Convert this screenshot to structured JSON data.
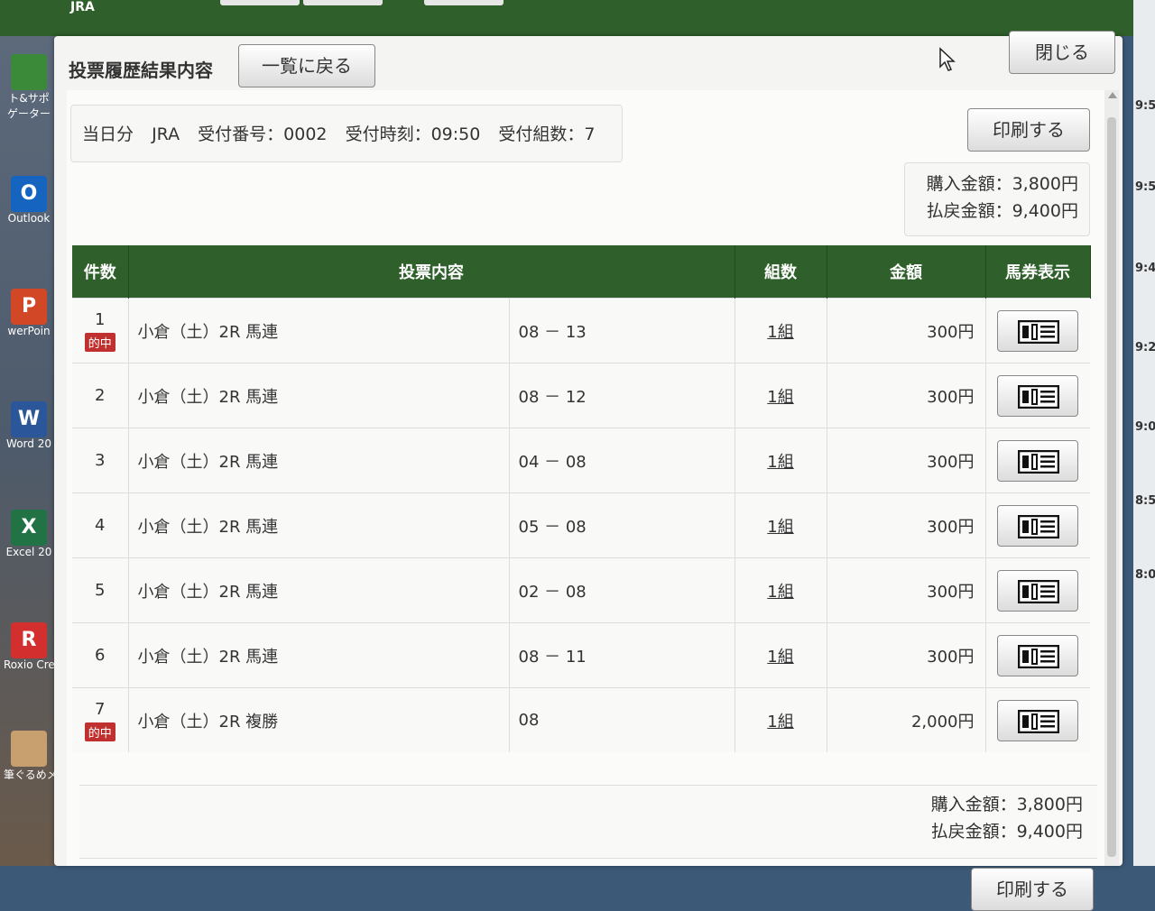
{
  "background": {
    "logo": "JRA",
    "desktop_icons": [
      {
        "label": "ト&サポ",
        "sub": "ゲーター",
        "glyph": "",
        "color": "#3a8a3a",
        "icon": "support-icon"
      },
      {
        "label": "Outlook",
        "sub": "",
        "glyph": "O",
        "color": "#1565c0",
        "icon": "outlook-icon"
      },
      {
        "label": "werPoin",
        "sub": "",
        "glyph": "P",
        "color": "#d24726",
        "icon": "powerpoint-icon"
      },
      {
        "label": "Word 20",
        "sub": "",
        "glyph": "W",
        "color": "#2b579a",
        "icon": "word-icon"
      },
      {
        "label": "Excel 20",
        "sub": "",
        "glyph": "X",
        "color": "#217346",
        "icon": "excel-icon"
      },
      {
        "label": "Roxio Crea",
        "sub": "",
        "glyph": "R",
        "color": "#d32f2f",
        "icon": "roxio-icon"
      },
      {
        "label": "筆ぐるめメ",
        "sub": "",
        "glyph": "",
        "color": "#c8a070",
        "icon": "fudegurume-icon"
      }
    ],
    "right_times": [
      "9:5",
      "9:5",
      "9:4",
      "9:2",
      "9:0",
      "8:5",
      "8:0"
    ]
  },
  "modal": {
    "title": "投票履歴結果内容",
    "back_label": "一覧に戻る",
    "close_label": "閉じる",
    "print_label": "印刷する",
    "info": {
      "day": "当日分",
      "org": "JRA",
      "receipt_no": "受付番号：0002",
      "receipt_time": "受付時刻：09:50",
      "receipt_sets": "受付組数：7"
    },
    "summary": {
      "purchase": "購入金額：3,800円",
      "payout": "払戻金額：9,400円"
    },
    "table": {
      "headers": {
        "count": "件数",
        "content": "投票内容",
        "sets": "組数",
        "amount": "金額",
        "ticket": "馬券表示"
      },
      "hit_label": "的中",
      "rows": [
        {
          "no": "1",
          "hit": true,
          "race": "小倉（土）2R 馬連",
          "combo": "08 － 13",
          "sets": "1組",
          "amount": "300円"
        },
        {
          "no": "2",
          "hit": false,
          "race": "小倉（土）2R 馬連",
          "combo": "08 － 12",
          "sets": "1組",
          "amount": "300円"
        },
        {
          "no": "3",
          "hit": false,
          "race": "小倉（土）2R 馬連",
          "combo": "04 － 08",
          "sets": "1組",
          "amount": "300円"
        },
        {
          "no": "4",
          "hit": false,
          "race": "小倉（土）2R 馬連",
          "combo": "05 － 08",
          "sets": "1組",
          "amount": "300円"
        },
        {
          "no": "5",
          "hit": false,
          "race": "小倉（土）2R 馬連",
          "combo": "02 － 08",
          "sets": "1組",
          "amount": "300円"
        },
        {
          "no": "6",
          "hit": false,
          "race": "小倉（土）2R 馬連",
          "combo": "08 － 11",
          "sets": "1組",
          "amount": "300円"
        },
        {
          "no": "7",
          "hit": true,
          "race": "小倉（土）2R 複勝",
          "combo": "08",
          "sets": "1組",
          "amount": "2,000円"
        }
      ]
    }
  }
}
